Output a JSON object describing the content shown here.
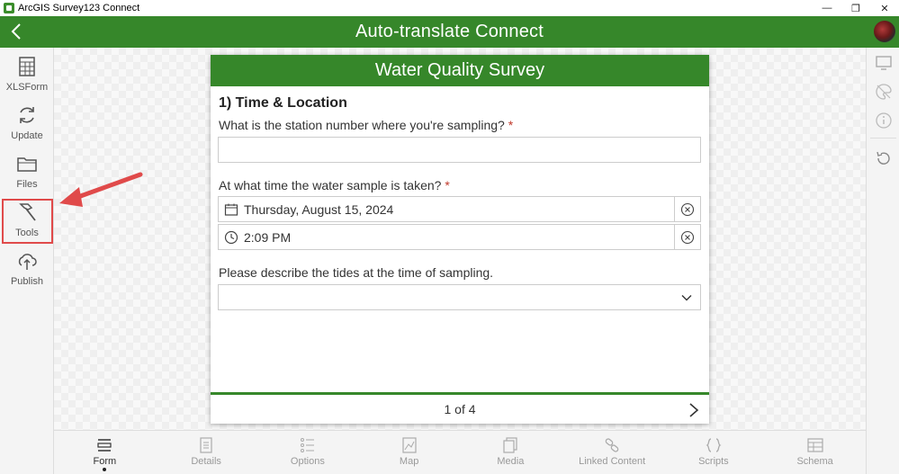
{
  "window": {
    "title": "ArcGIS Survey123 Connect"
  },
  "header": {
    "title": "Auto-translate Connect"
  },
  "sidebar": {
    "items": [
      {
        "label": "XLSForm",
        "icon": "spreadsheet-icon"
      },
      {
        "label": "Update",
        "icon": "refresh-icon"
      },
      {
        "label": "Files",
        "icon": "folder-icon"
      },
      {
        "label": "Tools",
        "icon": "hammer-icon"
      },
      {
        "label": "Publish",
        "icon": "cloud-upload-icon"
      }
    ]
  },
  "form": {
    "title": "Water Quality Survey",
    "section": "1) Time & Location",
    "q1": {
      "label": "What is the station number where you're sampling?",
      "required": "*",
      "value": ""
    },
    "q2": {
      "label": "At what time the water sample is taken?",
      "required": "*",
      "date": "Thursday, August 15, 2024",
      "time": "2:09 PM"
    },
    "q3": {
      "label": "Please describe the tides at the time of sampling.",
      "value": ""
    },
    "pager": "1 of 4"
  },
  "tabs": [
    {
      "label": "Form",
      "icon": "form-icon",
      "active": true
    },
    {
      "label": "Details",
      "icon": "details-icon"
    },
    {
      "label": "Options",
      "icon": "options-icon"
    },
    {
      "label": "Map",
      "icon": "map-icon"
    },
    {
      "label": "Media",
      "icon": "media-icon"
    },
    {
      "label": "Linked Content",
      "icon": "link-icon"
    },
    {
      "label": "Scripts",
      "icon": "scripts-icon"
    },
    {
      "label": "Schema",
      "icon": "schema-icon"
    }
  ],
  "colors": {
    "brand": "#36872a",
    "highlight": "#e04a4a",
    "required": "#c0392b"
  }
}
